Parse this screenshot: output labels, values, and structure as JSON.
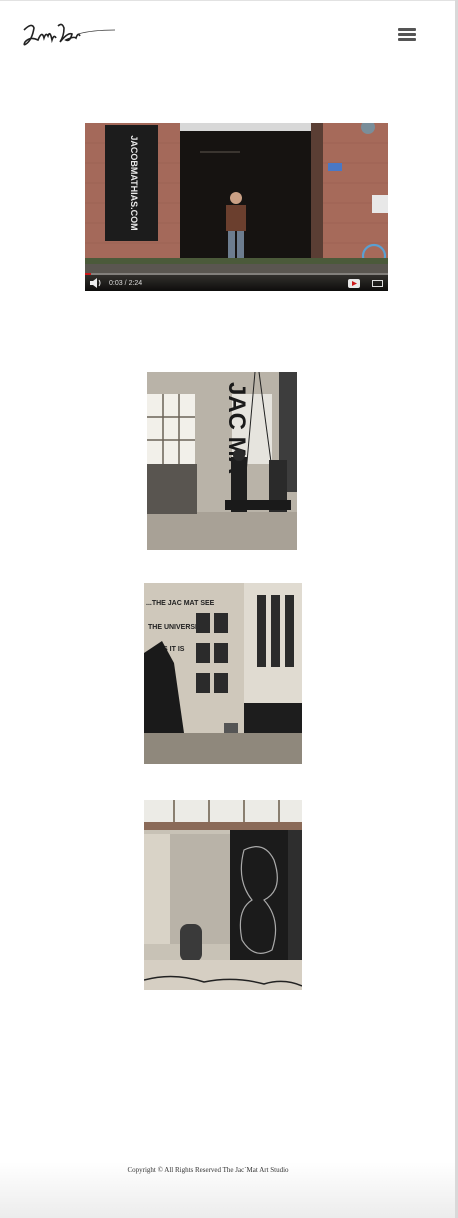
{
  "header": {
    "logo_icon": "signature-logo-icon",
    "menu_icon": "hamburger-menu-icon"
  },
  "video": {
    "current_time": "0:03",
    "separator": "/",
    "duration": "2:24",
    "progress": 0.021,
    "sign_text": "JACOBMATHIAS.COM",
    "icons": [
      "volume-icon",
      "youtube-icon",
      "fullscreen-icon"
    ],
    "accent": "#cc1818"
  },
  "gallery": {
    "photo1_wall_text": "JAC MA",
    "photo2_wall_text": [
      "...THE JAC MAT SEE",
      "THE UNIVERSE",
      "AS IT IS"
    ]
  },
  "footer": {
    "copyright": "Copyright ©  All Rights Reserved The Jac`Mat Art Studio"
  }
}
